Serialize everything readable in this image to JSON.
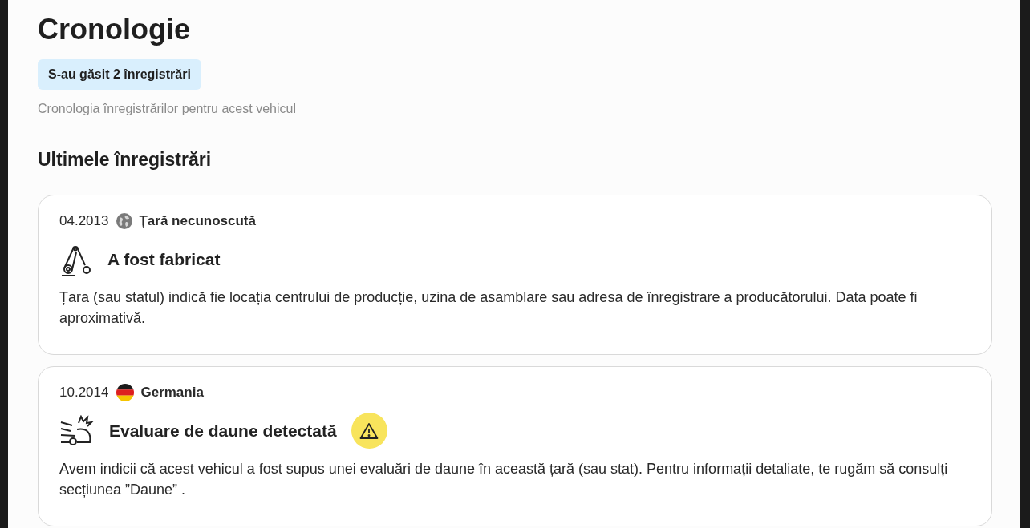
{
  "title": "Cronologie",
  "badge": "S-au găsit 2 înregistrări",
  "subtitle": "Cronologia înregistrărilor pentru acest vehicul",
  "section_title": "Ultimele înregistrări",
  "entries": [
    {
      "date": "04.2013",
      "flag": {
        "kind": "globe"
      },
      "country": "Țară necunoscută",
      "event_icon": {
        "kind": "factory"
      },
      "event": "A fost fabricat",
      "warning": false,
      "description": "Țara (sau statul) indică fie locația centrului de producție, uzina de asamblare sau adresa de înregistrare a producătorului. Data poate fi aproximativă."
    },
    {
      "date": "10.2014",
      "flag": {
        "kind": "germany"
      },
      "country": "Germania",
      "event_icon": {
        "kind": "crash"
      },
      "event": "Evaluare de daune detectată",
      "warning": true,
      "description": "Avem indicii că acest vehicul a fost supus unei evaluări de daune în această țară (sau stat). Pentru informații detaliate, te rugăm să consulți secțiunea ”Daune” ."
    }
  ]
}
